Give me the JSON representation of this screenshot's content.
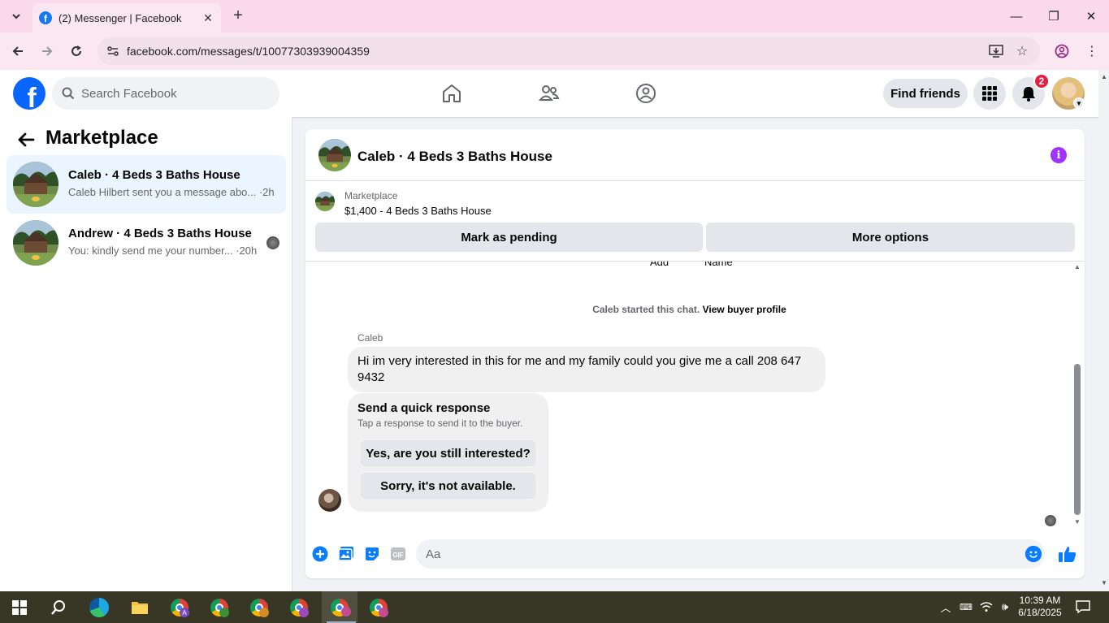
{
  "browser": {
    "tab_title": "(2) Messenger | Facebook",
    "url": "facebook.com/messages/t/10077303939004359"
  },
  "fb_header": {
    "search_placeholder": "Search Facebook",
    "find_friends": "Find friends",
    "notification_count": "2"
  },
  "sidebar": {
    "title": "Marketplace",
    "conversations": [
      {
        "title": "Caleb · 4 Beds 3 Baths House",
        "snippet": "Caleb Hilbert sent you a message abo... ·2h"
      },
      {
        "title": "Andrew · 4 Beds 3 Baths House",
        "snippet": "You: kindly send me your number... ·20h"
      }
    ]
  },
  "chat": {
    "title": "Caleb · 4 Beds 3 Baths House",
    "listing_label": "Marketplace",
    "listing_price": "$1,400 - 4 Beds 3 Baths House",
    "mark_pending": "Mark as pending",
    "more_options": "More options",
    "cut_label_add": "Add",
    "cut_label_name": "Name",
    "system_text": "Caleb started this chat.",
    "system_link": "View buyer profile",
    "sender": "Caleb",
    "message": "Hi im very interested in this for me and my family could you give me a call 208 647 9432",
    "quick_title": "Send a quick response",
    "quick_sub": "Tap a response to send it to the buyer.",
    "quick_opt1": "Yes, are you still interested?",
    "quick_opt2": "Sorry, it's not available.",
    "composer_placeholder": "Aa"
  },
  "taskbar": {
    "time": "10:39 AM",
    "date": "6/18/2025"
  }
}
